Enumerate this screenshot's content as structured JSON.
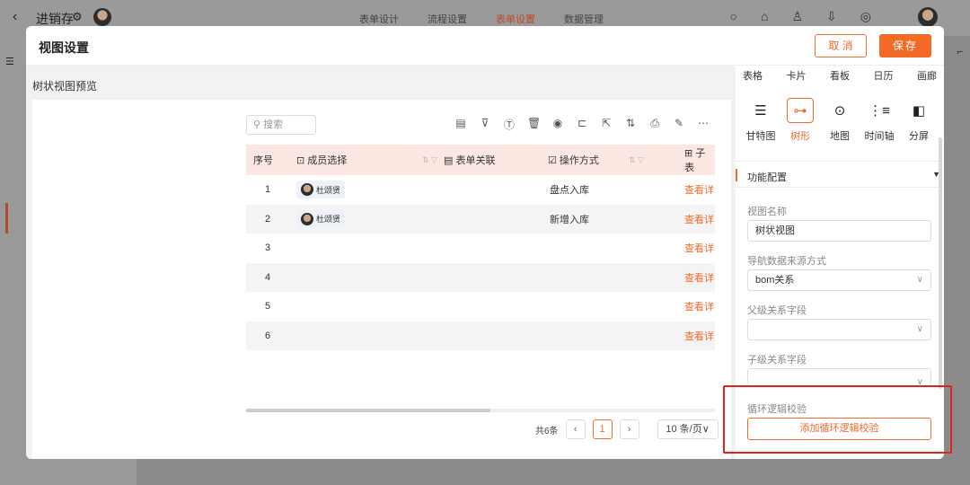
{
  "bg": {
    "app_title": "进销存",
    "tabs": [
      "表单设计",
      "流程设置",
      "表单设置",
      "数据管理"
    ],
    "active_tab": "表单设置"
  },
  "modal": {
    "title": "视图设置",
    "cancel_label": "取 消",
    "save_label": "保存"
  },
  "preview": {
    "label": "树状视图预览",
    "search_placeholder": "搜索",
    "table": {
      "headers": [
        "序号",
        "成员选择",
        "表单关联",
        "操作方式",
        "子表"
      ],
      "rows": [
        {
          "no": "1",
          "member": "杜颂贤",
          "op": "盘点入库",
          "action": "查看详"
        },
        {
          "no": "2",
          "member": "杜颂贤",
          "op": "新增入库",
          "action": "查看详"
        },
        {
          "no": "3",
          "member": "",
          "op": "",
          "action": "查看详"
        },
        {
          "no": "4",
          "member": "",
          "op": "",
          "action": "查看详"
        },
        {
          "no": "5",
          "member": "",
          "op": "",
          "action": "查看详"
        },
        {
          "no": "6",
          "member": "",
          "op": "",
          "action": "查看详"
        }
      ]
    },
    "pager": {
      "total": "共6条",
      "current": "1",
      "page_size": "10 条/页"
    }
  },
  "panel": {
    "view_types_row1": [
      "表格",
      "卡片",
      "看板",
      "日历",
      "画廊"
    ],
    "view_types_row2": [
      {
        "label": "甘特图",
        "icon": "gantt-icon"
      },
      {
        "label": "树形",
        "icon": "tree-icon"
      },
      {
        "label": "地图",
        "icon": "map-pin-icon"
      },
      {
        "label": "时间轴",
        "icon": "timeline-icon"
      },
      {
        "label": "分屏",
        "icon": "split-icon"
      }
    ],
    "active_view": "树形",
    "section_title": "功能配置",
    "view_name_label": "视图名称",
    "view_name_value": "树状视图",
    "nav_source_label": "导航数据来源方式",
    "nav_source_value": "bom关系",
    "parent_field_label": "父级关系字段",
    "child_field_label": "子级关系字段",
    "cycle_check_label": "循环逻辑校验",
    "add_cycle_check_label": "添加循环逻辑校验"
  },
  "colors": {
    "accent": "#f06a2d",
    "highlight_box": "#e2231a",
    "table_header": "#fde7e3"
  }
}
